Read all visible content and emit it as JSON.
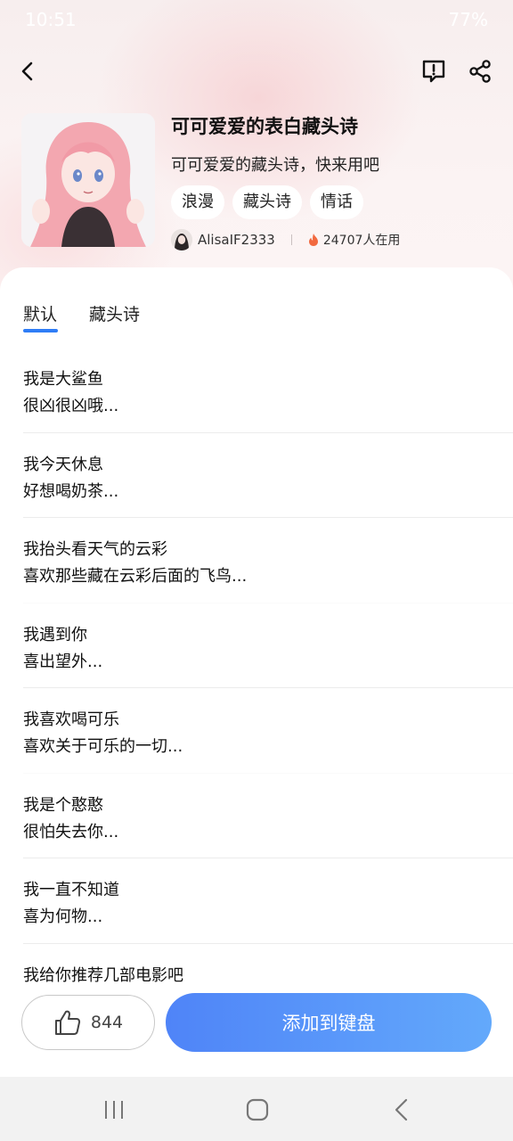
{
  "status_bar": {
    "time": "10:51",
    "battery": "77%"
  },
  "nav": {
    "back_icon": "back-arrow-icon",
    "report_icon": "report-icon",
    "share_icon": "share-icon"
  },
  "header": {
    "title": "可可爱爱的表白藏头诗",
    "subtitle": "可可爱爱的藏头诗，快来用吧",
    "tags": [
      "浪漫",
      "藏头诗",
      "情话"
    ],
    "author": "AlisaIF2333",
    "users_count": "24707人在用"
  },
  "tabs": [
    {
      "label": "默认",
      "active": true
    },
    {
      "label": "藏头诗",
      "active": false
    }
  ],
  "poems": [
    {
      "line1": "我是大鲨鱼",
      "line2": "很凶很凶哦..."
    },
    {
      "line1": "我今天休息",
      "line2": "好想喝奶茶..."
    },
    {
      "line1": "我抬头看天气的云彩",
      "line2": "喜欢那些藏在云彩后面的飞鸟..."
    },
    {
      "line1": "我遇到你",
      "line2": "喜出望外..."
    },
    {
      "line1": "我喜欢喝可乐",
      "line2": "喜欢关于可乐的一切..."
    },
    {
      "line1": "我是个憨憨",
      "line2": "很怕失去你..."
    },
    {
      "line1": "我一直不知道",
      "line2": "喜为何物..."
    },
    {
      "line1": "我给你推荐几部电影吧",
      "line2": ""
    }
  ],
  "bottom": {
    "like_count": "844",
    "add_button": "添加到键盘"
  },
  "colors": {
    "accent": "#2f7df6",
    "button_start": "#4f84f8",
    "button_end": "#63a9fb"
  }
}
